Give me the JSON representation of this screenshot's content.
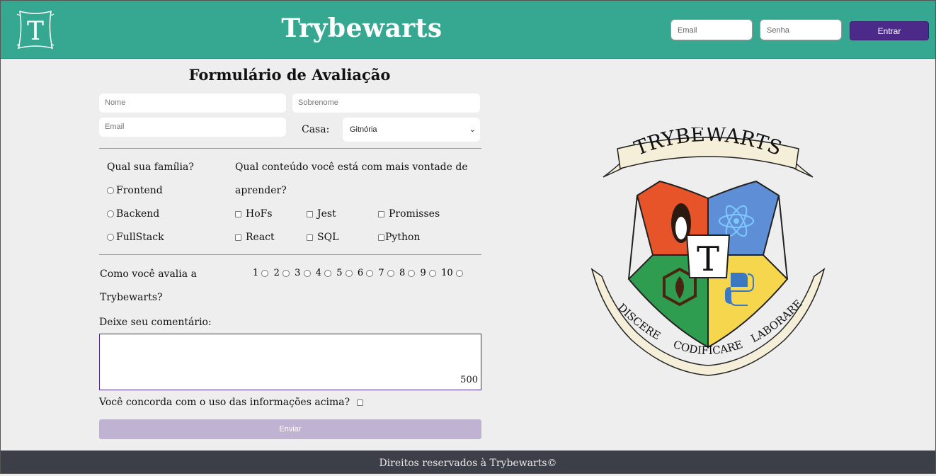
{
  "header": {
    "logo_letter": "T",
    "brand": "Trybewarts",
    "email_placeholder": "Email",
    "password_placeholder": "Senha",
    "login_label": "Entrar"
  },
  "form": {
    "title": "Formulário de Avaliação",
    "name_placeholder": "Nome",
    "surname_placeholder": "Sobrenome",
    "email_placeholder": "Email",
    "house_label": "Casa:",
    "house_value": "Gitnória",
    "family_question": "Qual sua família?",
    "families": [
      "Frontend",
      "Backend",
      "FullStack"
    ],
    "content_question_line1": "Qual conteúdo você está com mais vontade de",
    "content_question_line2": "aprender?",
    "subjects": [
      "HoFs",
      "Jest",
      "Promisses",
      "React",
      "SQL",
      "Python"
    ],
    "rate_label_line1": "Como você avalia a",
    "rate_label_line2": "Trybewarts?",
    "rates": [
      "1",
      "2",
      "3",
      "4",
      "5",
      "6",
      "7",
      "8",
      "9",
      "10"
    ],
    "comment_label": "Deixe seu comentário:",
    "counter": "500",
    "agreement_label": "Você concorda com o uso das informações acima?",
    "submit_label": "Enviar"
  },
  "crest": {
    "banner_text": "TRYBEWARTS",
    "center_letter": "T",
    "motto": [
      "DISCERE",
      "CODIFICARE",
      "LABORARE"
    ],
    "colors": {
      "red": "#e8542a",
      "blue": "#5e8fd6",
      "green": "#2f9d50",
      "yellow": "#f6d64d",
      "ribbon": "#f5eed8"
    }
  },
  "footer": {
    "text": "Direitos reservados à Trybewarts©"
  },
  "colors": {
    "header": "#36a891",
    "accent": "#4b2a8a",
    "footer": "#3d3f48"
  }
}
